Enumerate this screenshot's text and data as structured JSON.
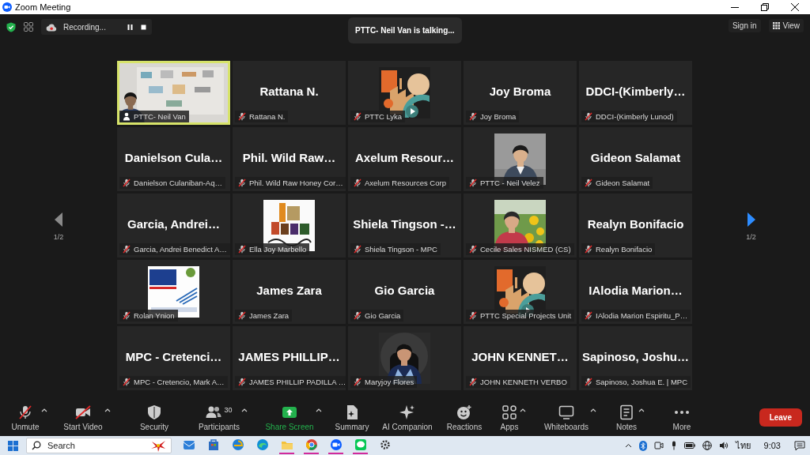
{
  "window": {
    "title": "Zoom Meeting"
  },
  "top_bar": {
    "recording": {
      "label": "Recording..."
    },
    "talking": "PTTC- Neil Van is talking...",
    "sign_in": "Sign in",
    "view": "View"
  },
  "pager": {
    "previous": {
      "label": "1/2",
      "disabled": true
    },
    "next": {
      "label": "1/2",
      "disabled": false
    }
  },
  "tiles": [
    {
      "kind": "video",
      "label": "PTTC- Neil Van",
      "muted": false,
      "speaking": true
    },
    {
      "kind": "name",
      "display_name": "Rattana N.",
      "label": "Rattana N.",
      "muted": true,
      "speaking": false
    },
    {
      "kind": "picture",
      "label": "PTTC Lyka",
      "muted": true,
      "speaking": false
    },
    {
      "kind": "name",
      "display_name": "Joy Broma",
      "label": "Joy Broma",
      "muted": true,
      "speaking": false
    },
    {
      "kind": "name",
      "display_name": "DDCI-(Kimberly…",
      "label": "DDCI-(Kimberly Lunod)",
      "muted": true,
      "speaking": false
    },
    {
      "kind": "name",
      "display_name": "Danielson Cula…",
      "label": "Danielson Culaniban-Aq…",
      "muted": true,
      "speaking": false
    },
    {
      "kind": "name",
      "display_name": "Phil. Wild Raw…",
      "label": "Phil. Wild Raw Honey Cor…",
      "muted": true,
      "speaking": false
    },
    {
      "kind": "name",
      "display_name": "Axelum Resour…",
      "label": "Axelum Resources Corp",
      "muted": true,
      "speaking": false
    },
    {
      "kind": "picture",
      "label": "PTTC - Neil Velez",
      "muted": true,
      "speaking": false
    },
    {
      "kind": "name",
      "display_name": "Gideon Salamat",
      "label": "Gideon Salamat",
      "muted": true,
      "speaking": false
    },
    {
      "kind": "name",
      "display_name": "Garcia, Andrei…",
      "label": "Garcia, Andrei Benedict A…",
      "muted": true,
      "speaking": false
    },
    {
      "kind": "picture",
      "label": "Ella Joy Marbello",
      "muted": true,
      "speaking": false
    },
    {
      "kind": "name",
      "display_name": "Shiela Tingson -…",
      "label": "Shiela Tingson - MPC",
      "muted": true,
      "speaking": false
    },
    {
      "kind": "picture",
      "label": "Cecile Sales NISMED (CS)",
      "muted": true,
      "speaking": false
    },
    {
      "kind": "name",
      "display_name": "Realyn Bonifacio",
      "label": "Realyn Bonifacio",
      "muted": true,
      "speaking": false
    },
    {
      "kind": "picture",
      "label": "Rolan Ynion",
      "muted": true,
      "speaking": false
    },
    {
      "kind": "name",
      "display_name": "James Zara",
      "label": "James Zara",
      "muted": true,
      "speaking": false
    },
    {
      "kind": "name",
      "display_name": "Gio Garcia",
      "label": "Gio Garcia",
      "muted": true,
      "speaking": false
    },
    {
      "kind": "picture",
      "label": "PTTC Special Projects Unit",
      "muted": true,
      "speaking": false
    },
    {
      "kind": "name",
      "display_name": "IAlodia Marion…",
      "label": "IAlodia Marion Espiritu_P…",
      "muted": true,
      "speaking": false
    },
    {
      "kind": "name",
      "display_name": "MPC - Cretenci…",
      "label": "MPC - Cretencio, Mark A…",
      "muted": true,
      "speaking": false
    },
    {
      "kind": "name",
      "display_name": "JAMES PHILLIP…",
      "label": "JAMES PHILLIP PADILLA …",
      "muted": true,
      "speaking": false
    },
    {
      "kind": "picture",
      "label": "Maryjoy Flores",
      "muted": true,
      "speaking": false
    },
    {
      "kind": "name",
      "display_name": "JOHN KENNET…",
      "label": "JOHN KENNETH VERBO",
      "muted": true,
      "speaking": false
    },
    {
      "kind": "name",
      "display_name": "Sapinoso, Joshu…",
      "label": "Sapinoso, Joshua E. | MPC",
      "muted": true,
      "speaking": false
    }
  ],
  "toolbar": {
    "items": [
      {
        "label": "Unmute",
        "kind": "tool",
        "off": true,
        "has_menu": true
      },
      {
        "label": "Start Video",
        "kind": "tool",
        "off": true,
        "has_menu": true
      },
      {
        "label": "Security",
        "kind": "tool",
        "off": false,
        "has_menu": false
      },
      {
        "label": "Participants",
        "kind": "tool",
        "count": "30",
        "off": false,
        "has_menu": true
      },
      {
        "label": "Share Screen",
        "kind": "primary",
        "off": false,
        "has_menu": true
      },
      {
        "label": "Summary",
        "kind": "tool",
        "off": false,
        "has_menu": false
      },
      {
        "label": "AI Companion",
        "kind": "tool",
        "off": false,
        "has_menu": false
      },
      {
        "label": "Reactions",
        "kind": "tool",
        "off": false,
        "has_menu": false
      },
      {
        "label": "Apps",
        "kind": "tool",
        "off": false,
        "has_menu": true
      },
      {
        "label": "Whiteboards",
        "kind": "tool",
        "off": false,
        "has_menu": true
      },
      {
        "label": "Notes",
        "kind": "tool",
        "off": false,
        "has_menu": true
      },
      {
        "label": "More",
        "kind": "tool",
        "off": false,
        "has_menu": false
      }
    ],
    "leave": "Leave"
  },
  "taskbar": {
    "search": {
      "placeholder": "Search"
    },
    "apps": [
      {
        "running": false
      },
      {
        "running": false
      },
      {
        "running": false
      },
      {
        "running": false
      },
      {
        "running": true
      },
      {
        "running": true
      },
      {
        "running": true
      },
      {
        "running": true
      },
      {
        "running": false
      }
    ],
    "language": "ไทย",
    "time": "9:03"
  }
}
